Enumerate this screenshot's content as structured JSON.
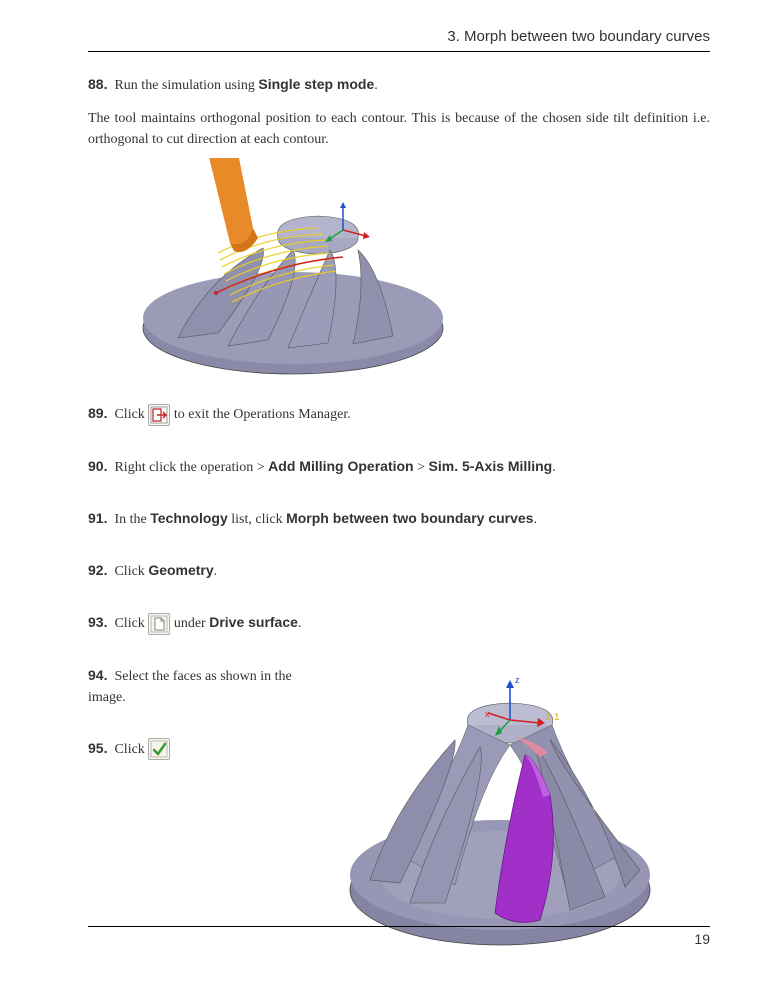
{
  "header": {
    "chapter": "3. Morph between two boundary curves"
  },
  "steps": {
    "s88": {
      "num": "88.",
      "prefix": "Run the simulation using ",
      "bold1": "Single step mode",
      "suffix": "."
    },
    "s88para": "The tool maintains orthogonal position to each contour. This is because of the chosen side tilt definition i.e. orthogonal to cut direction at each contour.",
    "s89": {
      "num": "89.",
      "prefix": "Click ",
      "suffix": " to exit the Operations Manager."
    },
    "s90": {
      "num": "90.",
      "prefix": "Right click the operation > ",
      "bold1": "Add Milling Operation",
      "mid": " > ",
      "bold2": "Sim. 5-Axis Milling",
      "suffix": "."
    },
    "s91": {
      "num": "91.",
      "prefix": "In the ",
      "bold1": "Technology",
      "mid": " list, click ",
      "bold2": "Morph between two boundary curves",
      "suffix": "."
    },
    "s92": {
      "num": "92.",
      "prefix": "Click ",
      "bold1": "Geometry",
      "suffix": "."
    },
    "s93": {
      "num": "93.",
      "prefix": "Click ",
      "mid": " under ",
      "bold1": "Drive surface",
      "suffix": "."
    },
    "s94": {
      "num": "94.",
      "text": "Select the faces as shown in the image."
    },
    "s95": {
      "num": "95.",
      "prefix": "Click "
    }
  },
  "footer": {
    "page": "19"
  }
}
